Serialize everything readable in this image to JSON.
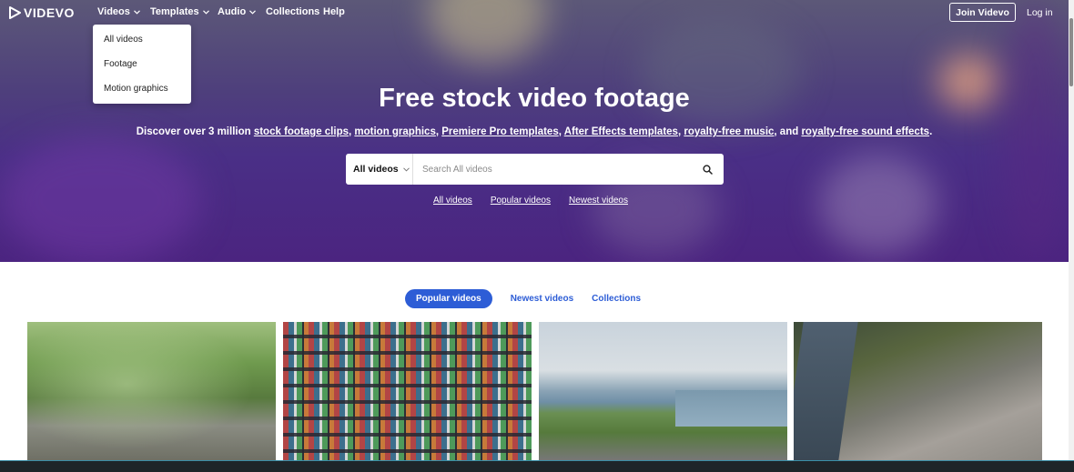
{
  "brand": {
    "name": "VIDEVO"
  },
  "nav": {
    "items": [
      {
        "label": "Videos",
        "has_dropdown": true
      },
      {
        "label": "Templates",
        "has_dropdown": true
      },
      {
        "label": "Audio",
        "has_dropdown": true
      },
      {
        "label": "Collections",
        "has_dropdown": false
      },
      {
        "label": "Help",
        "has_dropdown": false
      }
    ],
    "join_label": "Join Videvo",
    "login_label": "Log in"
  },
  "videos_dropdown": {
    "items": [
      "All videos",
      "Footage",
      "Motion graphics"
    ]
  },
  "hero": {
    "title": "Free stock video footage",
    "subtitle": {
      "prefix": "Discover over 3 million ",
      "link1": "stock footage clips",
      "sep1": ", ",
      "link2": "motion graphics",
      "sep2": ", ",
      "link3": "Premiere Pro templates",
      "sep3": ", ",
      "link4": "After Effects templates",
      "sep4": ", ",
      "link5": "royalty-free music",
      "sep5": ", and ",
      "link6": "royalty-free sound effects",
      "suffix": "."
    }
  },
  "search": {
    "category": "All videos",
    "placeholder": "Search All videos",
    "value": ""
  },
  "quick_links": [
    "All videos",
    "Popular videos",
    "Newest videos"
  ],
  "tabs": [
    {
      "label": "Popular videos",
      "active": true
    },
    {
      "label": "Newest videos",
      "active": false
    },
    {
      "label": "Collections",
      "active": false
    }
  ],
  "thumbnails": [
    {
      "name": "rain-puddle-thumbnail"
    },
    {
      "name": "shipping-containers-thumbnail"
    },
    {
      "name": "coastal-cliffs-thumbnail"
    },
    {
      "name": "aerial-city-thumbnail"
    }
  ],
  "colors": {
    "accent": "#2d5dd6",
    "hero_purple": "#4b2480",
    "bottom_bar": "#1e2529"
  }
}
